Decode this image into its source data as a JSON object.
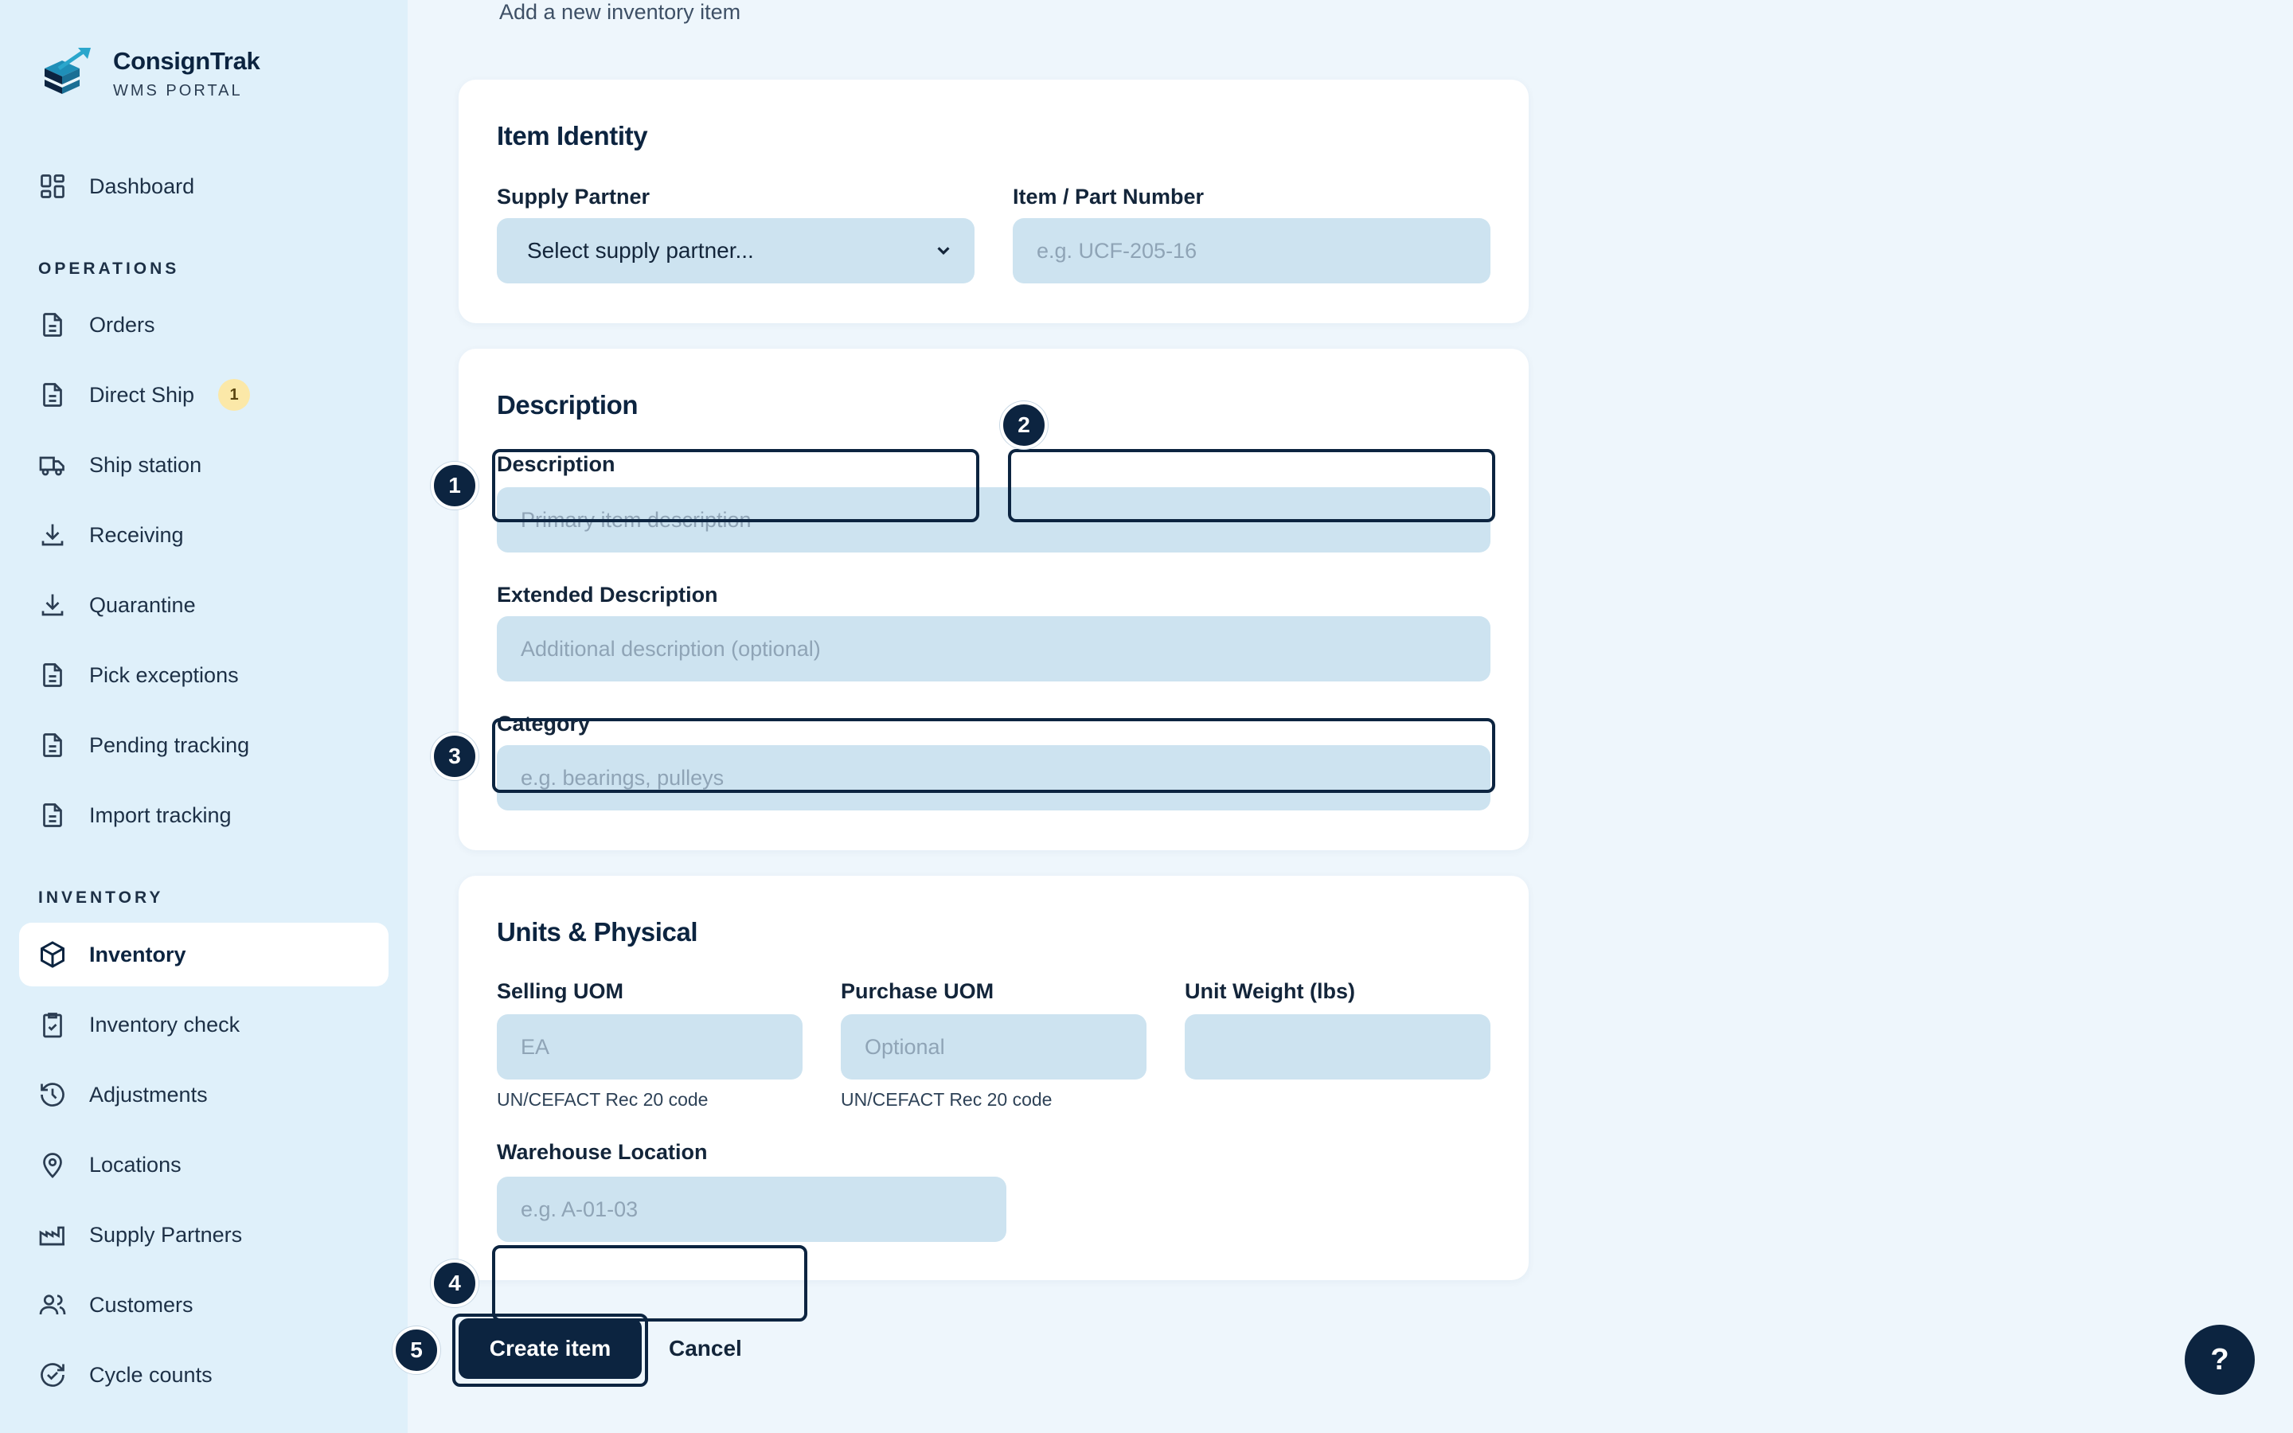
{
  "brand": {
    "name": "ConsignTrak",
    "subtitle": "WMS PORTAL"
  },
  "sidebar": {
    "top_item": {
      "label": "Dashboard",
      "icon": "grid-icon"
    },
    "sections": [
      {
        "heading": "OPERATIONS",
        "items": [
          {
            "label": "Orders",
            "icon": "document-icon"
          },
          {
            "label": "Direct Ship",
            "icon": "document-icon",
            "badge": "1"
          },
          {
            "label": "Ship station",
            "icon": "truck-icon"
          },
          {
            "label": "Receiving",
            "icon": "download-icon"
          },
          {
            "label": "Quarantine",
            "icon": "download-icon"
          },
          {
            "label": "Pick exceptions",
            "icon": "document-icon"
          },
          {
            "label": "Pending tracking",
            "icon": "document-icon"
          },
          {
            "label": "Import tracking",
            "icon": "document-icon"
          }
        ]
      },
      {
        "heading": "INVENTORY",
        "items": [
          {
            "label": "Inventory",
            "icon": "box-icon",
            "active": true
          },
          {
            "label": "Inventory check",
            "icon": "clipboard-check-icon"
          },
          {
            "label": "Adjustments",
            "icon": "history-icon"
          },
          {
            "label": "Locations",
            "icon": "map-pin-icon"
          },
          {
            "label": "Supply Partners",
            "icon": "factory-icon"
          },
          {
            "label": "Customers",
            "icon": "users-icon"
          },
          {
            "label": "Cycle counts",
            "icon": "refresh-check-icon"
          }
        ]
      }
    ]
  },
  "page": {
    "subtitle": "Add a new inventory item"
  },
  "item_identity": {
    "title": "Item Identity",
    "supply_partner": {
      "label": "Supply Partner",
      "value": "Select supply partner..."
    },
    "part_number": {
      "label": "Item / Part Number",
      "placeholder": "e.g. UCF-205-16"
    }
  },
  "description_card": {
    "title": "Description",
    "description": {
      "label": "Description",
      "placeholder": "Primary item description"
    },
    "extended": {
      "label": "Extended Description",
      "placeholder": "Additional description (optional)"
    },
    "category": {
      "label": "Category",
      "placeholder": "e.g. bearings, pulleys"
    }
  },
  "units_card": {
    "title": "Units & Physical",
    "selling_uom": {
      "label": "Selling UOM",
      "placeholder": "EA",
      "hint": "UN/CEFACT Rec 20 code"
    },
    "purchase_uom": {
      "label": "Purchase UOM",
      "placeholder": "Optional",
      "hint": "UN/CEFACT Rec 20 code"
    },
    "unit_weight": {
      "label": "Unit Weight (lbs)",
      "placeholder": ""
    },
    "warehouse_location": {
      "label": "Warehouse Location",
      "placeholder": "e.g. A-01-03"
    }
  },
  "markers": [
    "1",
    "2",
    "3",
    "4",
    "5"
  ],
  "actions": {
    "create": "Create item",
    "cancel": "Cancel"
  },
  "help": {
    "label": "?"
  },
  "colors": {
    "primary": "#0c2440",
    "input_bg": "#cde3f0",
    "sidebar_bg": "#dff0fa",
    "page_bg": "#eef6fc"
  }
}
